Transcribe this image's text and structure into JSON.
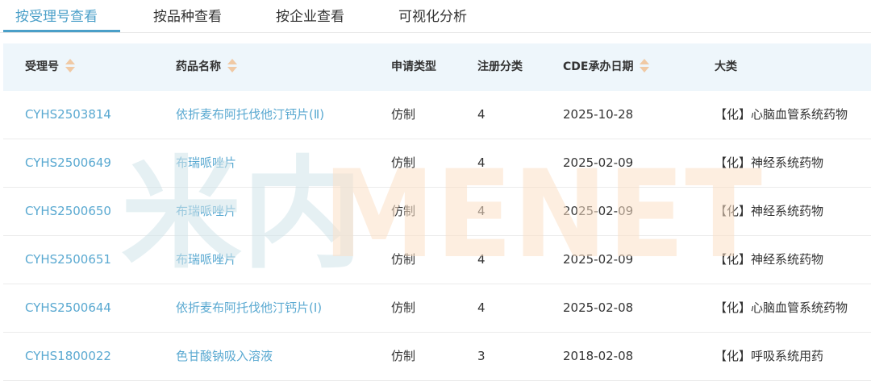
{
  "tabs": [
    {
      "label": "按受理号查看",
      "active": true
    },
    {
      "label": "按品种查看",
      "active": false
    },
    {
      "label": "按企业查看",
      "active": false
    },
    {
      "label": "可视化分析",
      "active": false
    }
  ],
  "table": {
    "headers": [
      "受理号",
      "药品名称",
      "申请类型",
      "注册分类",
      "CDE承办日期",
      "大类"
    ],
    "sortable": [
      true,
      true,
      false,
      false,
      true,
      false
    ],
    "rows": [
      {
        "id": "CYHS2503814",
        "name": "依折麦布阿托伐他汀钙片(Ⅱ)",
        "type": "仿制",
        "cls": "4",
        "date": "2025-10-28",
        "category": "【化】心脑血管系统药物"
      },
      {
        "id": "CYHS2500649",
        "name": "布瑞哌唑片",
        "type": "仿制",
        "cls": "4",
        "date": "2025-02-09",
        "category": "【化】神经系统药物"
      },
      {
        "id": "CYHS2500650",
        "name": "布瑞哌唑片",
        "type": "仿制",
        "cls": "4",
        "date": "2025-02-09",
        "category": "【化】神经系统药物"
      },
      {
        "id": "CYHS2500651",
        "name": "布瑞哌唑片",
        "type": "仿制",
        "cls": "4",
        "date": "2025-02-09",
        "category": "【化】神经系统药物"
      },
      {
        "id": "CYHS2500644",
        "name": "依折麦布阿托伐他汀钙片(Ⅰ)",
        "type": "仿制",
        "cls": "4",
        "date": "2025-02-08",
        "category": "【化】心脑血管系统药物"
      },
      {
        "id": "CYHS1800022",
        "name": "色甘酸钠吸入溶液",
        "type": "仿制",
        "cls": "3",
        "date": "2018-02-08",
        "category": "【化】呼吸系统用药"
      }
    ]
  },
  "watermark": {
    "prefix": "米内",
    "brand": "MENET"
  },
  "colors": {
    "accent": "#4a9fc8",
    "link": "#5aa9d1",
    "header_bg": "#eef6fb",
    "sort_icon": "#f0c9a4",
    "watermark_blue": "#cfe3ea",
    "watermark_orange": "#fbe0c6"
  }
}
